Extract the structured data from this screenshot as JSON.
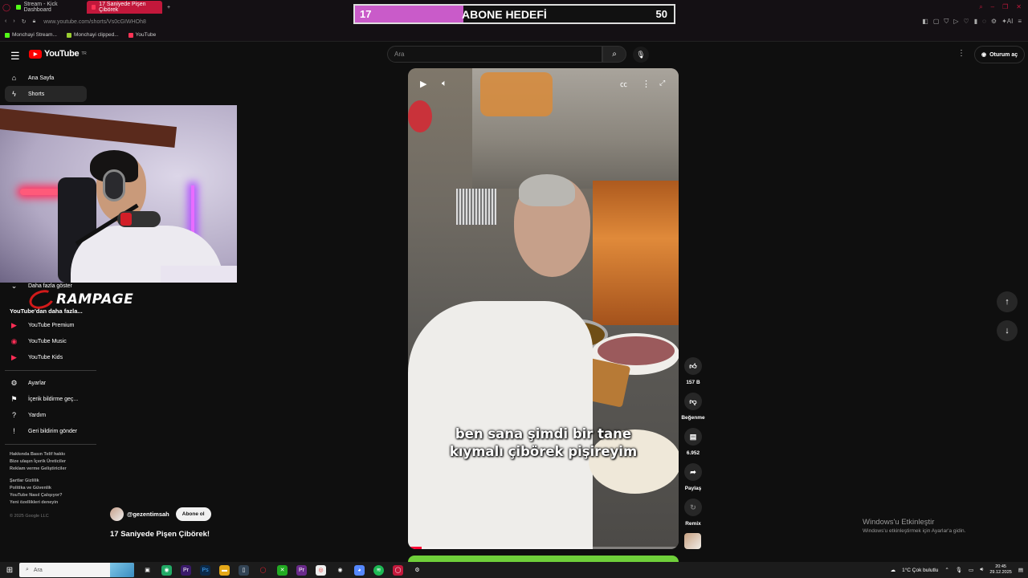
{
  "browser": {
    "tabs": [
      {
        "label": "Stream - Kick Dashboard",
        "active": false
      },
      {
        "label": "17 Saniyede Pişen Çibörek",
        "active": true
      }
    ],
    "new_tab": "+",
    "url": "www.youtube.com/shorts/Vs0cGIWHOh8",
    "bookmarks": [
      "Monchayi Stream...",
      "Monchayi clipped...",
      "YouTube"
    ]
  },
  "overlay": {
    "current": "17",
    "title": "ABONE HEDEFİ",
    "goal": "50",
    "progress": 0.34,
    "fill_color": "#c95bc9"
  },
  "header": {
    "logo": "YouTube",
    "country": "TR",
    "search_placeholder": "Ara",
    "signin_label": "Oturum aç"
  },
  "sidebar": {
    "items": [
      {
        "label": "Ana Sayfa",
        "icon": "home-icon",
        "selected": false
      },
      {
        "label": "Shorts",
        "icon": "shorts-icon",
        "selected": true
      }
    ],
    "show_more": "Daha fazla göster",
    "more_from_heading": "YouTube'dan daha fazla...",
    "more_from": [
      {
        "label": "YouTube Premium",
        "icon": "youtube-premium-icon"
      },
      {
        "label": "YouTube Music",
        "icon": "youtube-music-icon"
      },
      {
        "label": "YouTube Kids",
        "icon": "youtube-kids-icon"
      }
    ],
    "settings": [
      {
        "label": "Ayarlar",
        "icon": "gear-icon"
      },
      {
        "label": "İçerik bildirme geç...",
        "icon": "flag-icon"
      },
      {
        "label": "Yardım",
        "icon": "help-icon"
      },
      {
        "label": "Geri bildirim gönder",
        "icon": "feedback-icon"
      }
    ],
    "footer_links_1": [
      "Hakkında",
      "Basın",
      "Telif hakkı",
      "Bize ulaşın",
      "İçerik Üreticiler",
      "Reklam verme",
      "Geliştiriciler"
    ],
    "footer_links_2": [
      "Şartlar",
      "Gizlilik",
      "Politika ve Güvenlik",
      "YouTube Nasıl Çalışıyor?",
      "Yeni özellikleri deneyin"
    ],
    "copyright": "© 2025 Google LLC"
  },
  "stream_overlay": {
    "brand": "RAMPAGE"
  },
  "video": {
    "caption_line1": "ben sana şimdi bir tane",
    "caption_line2": "kıymalı çibörek pişireyim",
    "progress": 0.05,
    "channel": "@gezentimsah",
    "subscribe_label": "Abone ol",
    "title": "17 Saniyede Pişen Çibörek!"
  },
  "actions": {
    "like_count": "157 B",
    "dislike_label": "Beğenme",
    "comment_count": "6.952",
    "share_label": "Paylaş",
    "remix_label": "Remix"
  },
  "watermark": {
    "line1": "Windows'u Etkinleştir",
    "line2": "Windows'u etkinleştirmek için Ayarlar'a gidin."
  },
  "taskbar": {
    "search_placeholder": "Ara",
    "weather": "1°C  Çok bulutlu",
    "time": "20:45",
    "date": "29.12.2025"
  }
}
